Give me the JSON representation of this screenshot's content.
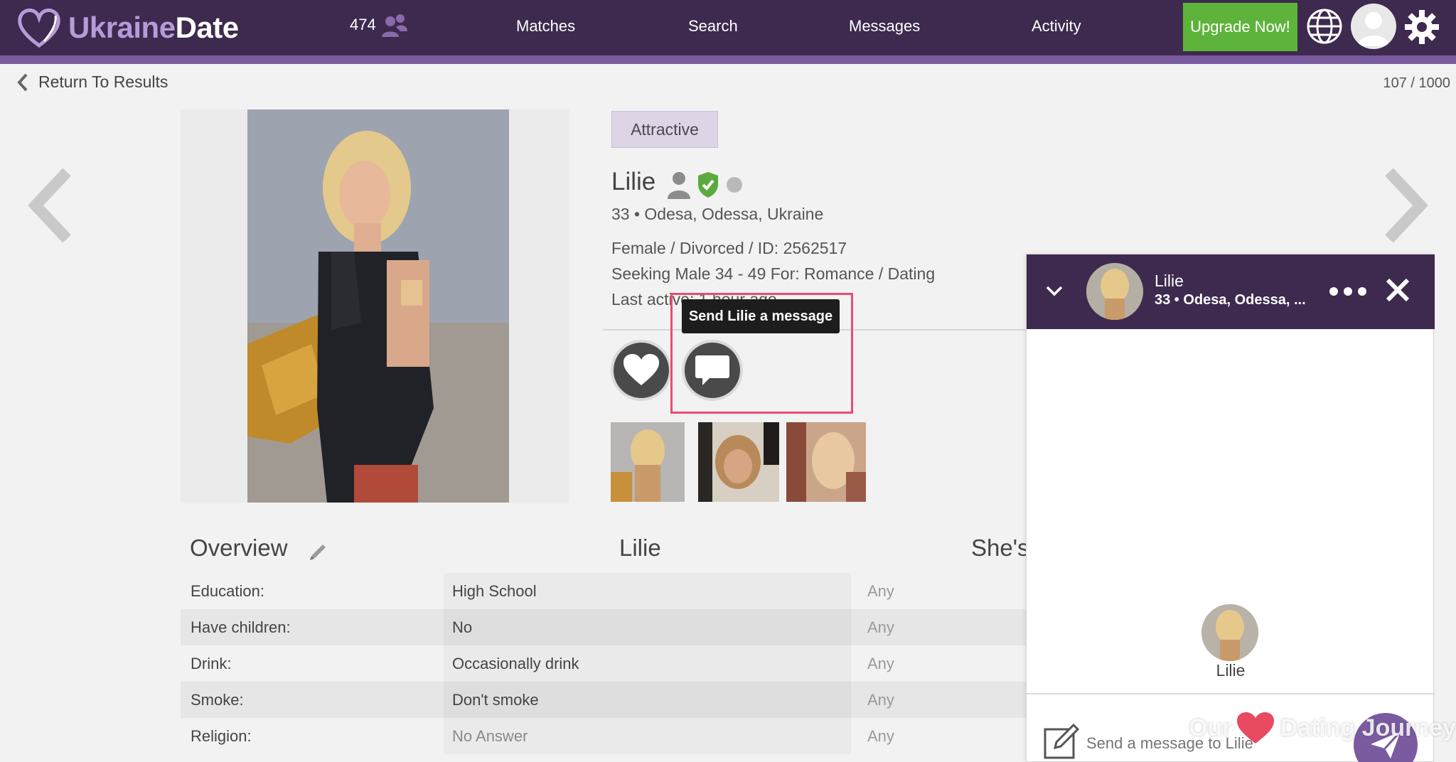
{
  "brand": {
    "part1": "Ukraine",
    "part2": "Date"
  },
  "nav": {
    "count": "474",
    "items": [
      "Matches",
      "Search",
      "Messages",
      "Activity"
    ],
    "upgrade_label": "Upgrade Now!"
  },
  "return_label": "Return To Results",
  "result_counter": "107 / 1000",
  "profile": {
    "tag": "Attractive",
    "name": "Lilie",
    "location_line": "33 • Odesa, Odessa, Ukraine",
    "details_line": "Female / Divorced / ID: 2562517",
    "seeking_line": "Seeking Male 34 - 49 For: Romance / Dating",
    "last_active_line": "Last active: 1 hour ago",
    "tooltip": "Send Lilie a message"
  },
  "overview": {
    "title": "Overview",
    "col2_title": "Lilie",
    "col3_title": "She's",
    "rows": [
      {
        "label": "Education:",
        "value": "High School",
        "seeking": "Any"
      },
      {
        "label": "Have children:",
        "value": "No",
        "seeking": "Any"
      },
      {
        "label": "Drink:",
        "value": "Occasionally drink",
        "seeking": "Any"
      },
      {
        "label": "Smoke:",
        "value": "Don't smoke",
        "seeking": "Any"
      },
      {
        "label": "Religion:",
        "value": "No Answer",
        "seeking": "Any"
      }
    ]
  },
  "chat": {
    "name": "Lilie",
    "location": "33 • Odesa, Odessa, ...",
    "contact_name": "Lilie",
    "input_placeholder": "Send a message to Lilie"
  },
  "watermark": {
    "left": "Our",
    "right": "Dating Journey"
  },
  "colors": {
    "nav_bg": "#3d2a4e",
    "accent_purple": "#7b5ba0",
    "upgrade_green": "#5eb43a",
    "verified_green": "#5aab3e",
    "highlight_pink": "#ea4c72"
  }
}
